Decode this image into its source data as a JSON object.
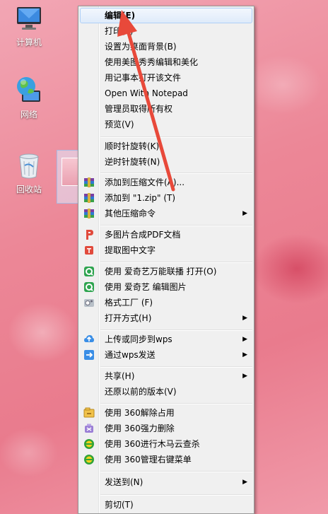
{
  "desktop": {
    "icons": [
      {
        "label": "计算机"
      },
      {
        "label": "网络"
      },
      {
        "label": "回收站"
      }
    ]
  },
  "context_menu": {
    "items": [
      {
        "label": "编辑(E)"
      },
      {
        "label": "打印(P)"
      },
      {
        "label": "设置为桌面背景(B)"
      },
      {
        "label": "使用美图秀秀编辑和美化"
      },
      {
        "label": "用记事本打开该文件"
      },
      {
        "label": "Open With Notepad"
      },
      {
        "label": "管理员取得所有权"
      },
      {
        "label": "预览(V)"
      },
      {
        "label": "顺时针旋转(K)"
      },
      {
        "label": "逆时针旋转(N)"
      },
      {
        "label": "添加到压缩文件(A)..."
      },
      {
        "label": "添加到 \"1.zip\" (T)"
      },
      {
        "label": "其他压缩命令"
      },
      {
        "label": "多图片合成PDF文档"
      },
      {
        "label": "提取图中文字"
      },
      {
        "label": "使用 爱奇艺万能联播 打开(O)"
      },
      {
        "label": "使用 爱奇艺 编辑图片"
      },
      {
        "label": "格式工厂 (F)"
      },
      {
        "label": "打开方式(H)"
      },
      {
        "label": "上传或同步到wps"
      },
      {
        "label": "通过wps发送"
      },
      {
        "label": "共享(H)"
      },
      {
        "label": "还原以前的版本(V)"
      },
      {
        "label": "使用 360解除占用"
      },
      {
        "label": "使用 360强力删除"
      },
      {
        "label": "使用 360进行木马云查杀"
      },
      {
        "label": "使用 360管理右键菜单"
      },
      {
        "label": "发送到(N)"
      },
      {
        "label": "剪切(T)"
      }
    ],
    "icon_names": {
      "winrar": "winrar-archive-icon",
      "pdf": "pdf-merge-icon",
      "ocr": "text-extract-icon",
      "iqiyi": "iqiyi-icon",
      "formatfactory": "format-factory-icon",
      "wps_upload": "wps-cloud-upload-icon",
      "wps_send": "wps-send-icon",
      "360": "360-security-icon"
    },
    "hover_item": "编辑(E)",
    "accent_color": "#e8493a"
  }
}
